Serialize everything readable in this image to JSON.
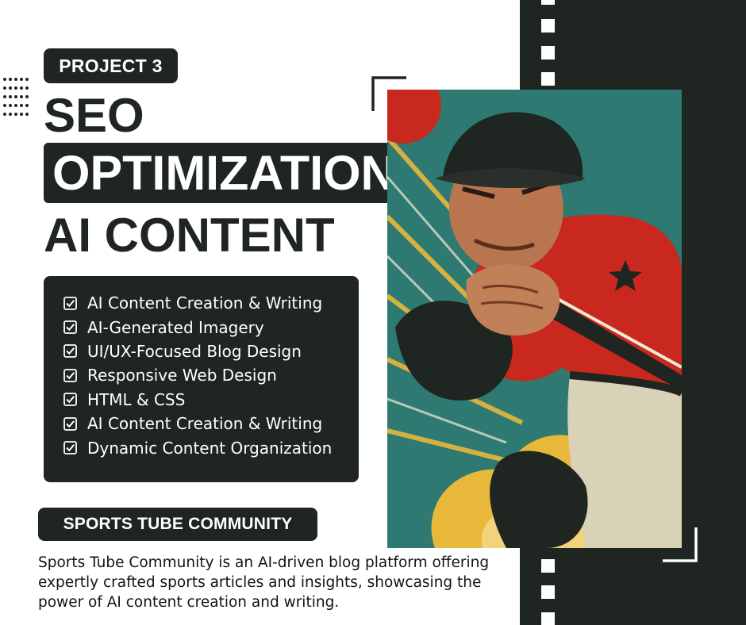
{
  "project_label": "PROJECT 3",
  "title": {
    "line1": "SEO",
    "line2": "OPTIMIZATION",
    "line3": "AI CONTENT"
  },
  "skills": [
    "AI Content Creation & Writing",
    "AI-Generated Imagery",
    "UI/UX-Focused Blog Design",
    "Responsive Web Design",
    "HTML & CSS",
    "AI Content Creation & Writing",
    "Dynamic Content Organization"
  ],
  "community": {
    "name": "SPORTS TUBE COMMUNITY",
    "description": "Sports Tube Community is an AI-driven blog platform offering expertly crafted sports articles and insights, showcasing the power of AI content creation and writing."
  },
  "icons": {
    "bullet": "checkbox-checked-icon",
    "illustration": "baseball-pitcher-illustration"
  },
  "colors": {
    "dark": "#1f2520",
    "light": "#ffffff",
    "jersey_red": "#c8281e",
    "teal": "#2e7a72",
    "yellow": "#e8b83a"
  }
}
